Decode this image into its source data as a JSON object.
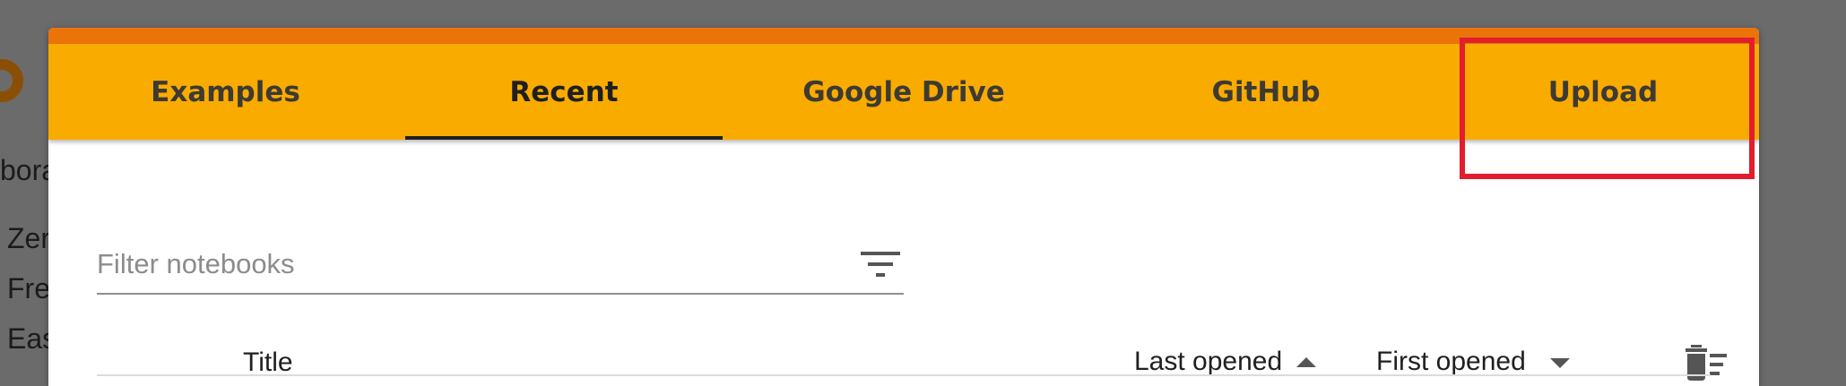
{
  "background": {
    "text_fragments": [
      "bora",
      "Zer",
      "Fre",
      "Eas"
    ]
  },
  "dialog": {
    "accent_color": "#f9ab00",
    "topbar_color": "#ea7409",
    "tabs": [
      {
        "label": "Examples",
        "active": false
      },
      {
        "label": "Recent",
        "active": true
      },
      {
        "label": "Google Drive",
        "active": false
      },
      {
        "label": "GitHub",
        "active": false
      },
      {
        "label": "Upload",
        "active": false
      }
    ],
    "highlight_color": "#e21d2c",
    "filter": {
      "placeholder": "Filter notebooks",
      "value": "",
      "icon": "filter-list-icon"
    },
    "table": {
      "columns": {
        "title": "Title",
        "last_opened": "Last opened",
        "first_opened": "First opened"
      },
      "sort_icons": {
        "last_opened": "arrow-up-icon",
        "first_opened": "arrow-down-icon"
      },
      "delete_icon": "delete-sweep-icon"
    }
  }
}
